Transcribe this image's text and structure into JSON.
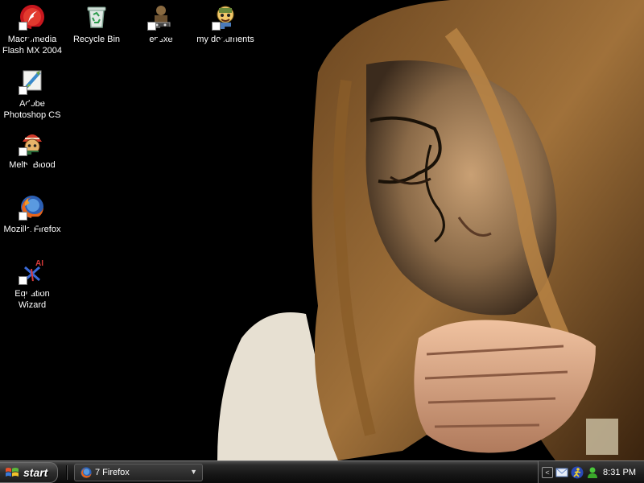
{
  "desktop": {
    "icons": [
      {
        "label": "Macromedia\nFlash MX 2004",
        "icon": "flash-icon"
      },
      {
        "label": "Recycle Bin",
        "icon": "recycle-bin-icon"
      },
      {
        "label": "epsxe",
        "icon": "epsxe-icon"
      },
      {
        "label": "my documents",
        "icon": "my-documents-icon"
      },
      {
        "label": "Adobe\nPhotoshop CS",
        "icon": "photoshop-icon"
      },
      {
        "label": "Melty Blood",
        "icon": "melty-blood-icon"
      },
      {
        "label": "Mozilla Firefox",
        "icon": "firefox-icon"
      },
      {
        "label": "Equation\nWizard",
        "icon": "equation-wizard-icon"
      }
    ]
  },
  "taskbar": {
    "start_label": "start",
    "task_group_label": "7 Firefox",
    "tray_icons": [
      "show-hidden-icon",
      "mail-icon",
      "messenger-running-icon",
      "messenger-buddy-icon"
    ],
    "clock": "8:31 PM"
  }
}
